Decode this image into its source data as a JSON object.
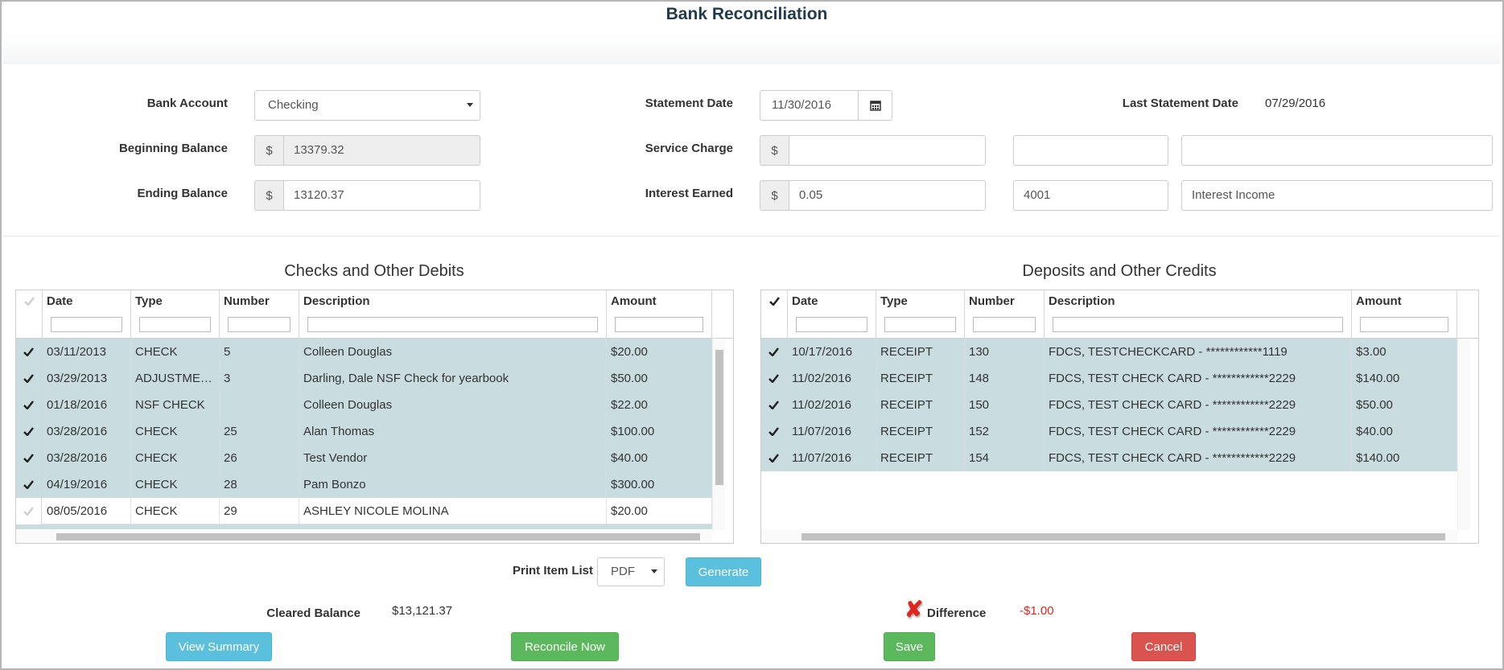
{
  "title": "Bank Reconciliation",
  "form": {
    "bank_account": {
      "label": "Bank Account",
      "value": "Checking"
    },
    "beginning_balance": {
      "label": "Beginning Balance",
      "prefix": "$",
      "value": "13379.32"
    },
    "ending_balance": {
      "label": "Ending Balance",
      "prefix": "$",
      "value": "13120.37"
    },
    "statement_date": {
      "label": "Statement Date",
      "value": "11/30/2016"
    },
    "service_charge": {
      "label": "Service Charge",
      "prefix": "$",
      "value": "",
      "account": "",
      "account_name": ""
    },
    "interest_earned": {
      "label": "Interest Earned",
      "prefix": "$",
      "value": "0.05",
      "account": "4001",
      "account_name": "Interest Income"
    },
    "last_statement_date": {
      "label": "Last Statement Date",
      "value": "07/29/2016"
    }
  },
  "debits": {
    "title": "Checks and Other Debits",
    "columns": [
      "Date",
      "Type",
      "Number",
      "Description",
      "Amount"
    ],
    "rows": [
      {
        "date": "03/11/2013",
        "type": "CHECK",
        "number": "5",
        "description": "Colleen Douglas",
        "amount": "$20.00",
        "cleared": true
      },
      {
        "date": "03/29/2013",
        "type": "ADJUSTME…",
        "number": "3",
        "description": "Darling, Dale NSF Check for yearbook",
        "amount": "$50.00",
        "cleared": true
      },
      {
        "date": "01/18/2016",
        "type": "NSF CHECK",
        "number": "",
        "description": "Colleen Douglas",
        "amount": "$22.00",
        "cleared": true
      },
      {
        "date": "03/28/2016",
        "type": "CHECK",
        "number": "25",
        "description": "Alan Thomas",
        "amount": "$100.00",
        "cleared": true
      },
      {
        "date": "03/28/2016",
        "type": "CHECK",
        "number": "26",
        "description": "Test Vendor",
        "amount": "$40.00",
        "cleared": true
      },
      {
        "date": "04/19/2016",
        "type": "CHECK",
        "number": "28",
        "description": "Pam Bonzo",
        "amount": "$300.00",
        "cleared": true
      },
      {
        "date": "08/05/2016",
        "type": "CHECK",
        "number": "29",
        "description": "ASHLEY NICOLE MOLINA",
        "amount": "$20.00",
        "cleared": false
      }
    ]
  },
  "credits": {
    "title": "Deposits and Other Credits",
    "columns": [
      "Date",
      "Type",
      "Number",
      "Description",
      "Amount"
    ],
    "rows": [
      {
        "date": "10/17/2016",
        "type": "RECEIPT",
        "number": "130",
        "description": "FDCS, TESTCHECKCARD - ************1119",
        "amount": "$3.00",
        "cleared": true
      },
      {
        "date": "11/02/2016",
        "type": "RECEIPT",
        "number": "148",
        "description": "FDCS, TEST CHECK CARD - ************2229",
        "amount": "$140.00",
        "cleared": true
      },
      {
        "date": "11/02/2016",
        "type": "RECEIPT",
        "number": "150",
        "description": "FDCS, TEST CHECK CARD - ************2229",
        "amount": "$50.00",
        "cleared": true
      },
      {
        "date": "11/07/2016",
        "type": "RECEIPT",
        "number": "152",
        "description": "FDCS, TEST CHECK CARD - ************2229",
        "amount": "$40.00",
        "cleared": true
      },
      {
        "date": "11/07/2016",
        "type": "RECEIPT",
        "number": "154",
        "description": "FDCS, TEST CHECK CARD - ************2229",
        "amount": "$140.00",
        "cleared": true
      }
    ]
  },
  "print": {
    "label": "Print Item List",
    "format": "PDF",
    "generate_label": "Generate"
  },
  "summary": {
    "cleared_balance_label": "Cleared Balance",
    "cleared_balance": "$13,121.37",
    "difference_label": "Difference",
    "difference": "-$1.00",
    "difference_color": "#e0261f"
  },
  "actions": {
    "view_summary": "View Summary",
    "reconcile_now": "Reconcile Now",
    "save": "Save",
    "cancel": "Cancel"
  },
  "colors": {
    "selected_row": "#c9dce0",
    "info": "#5bc0de",
    "success": "#5cb85c",
    "danger": "#d9534f"
  }
}
